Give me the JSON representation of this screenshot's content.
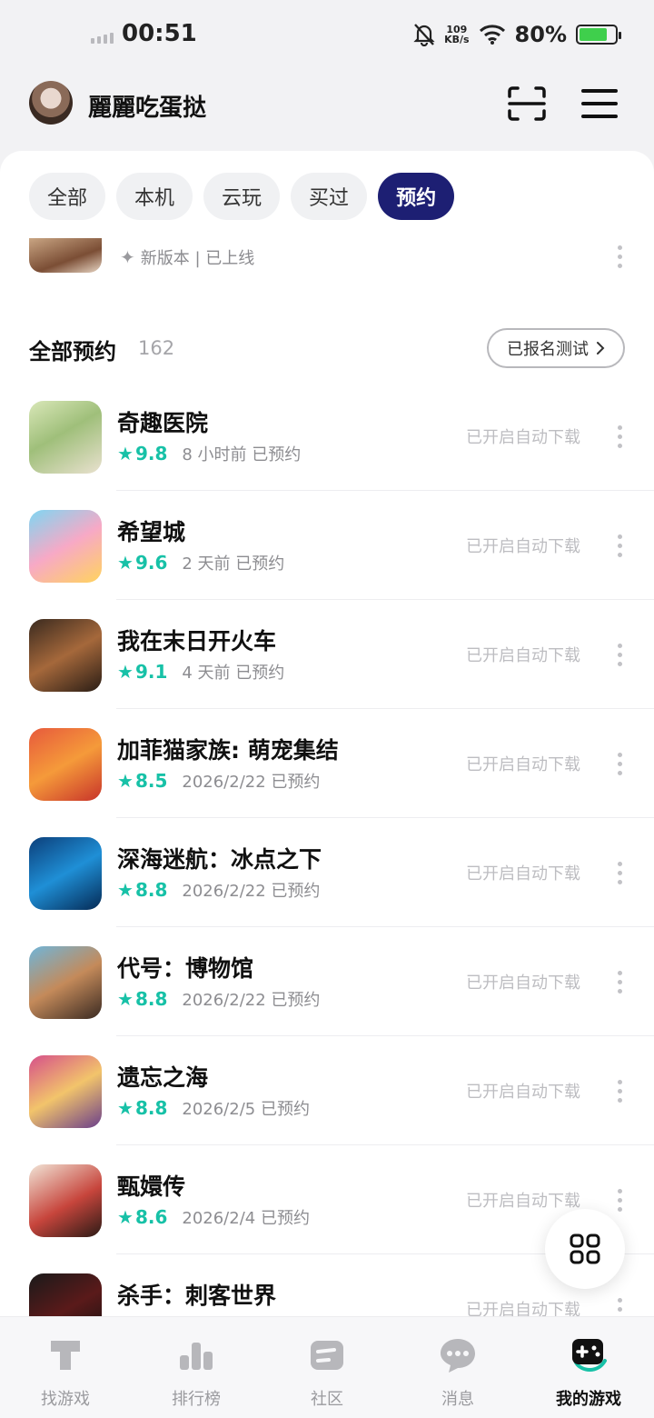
{
  "status_bar": {
    "time": "00:51",
    "net_speed_value": "109",
    "net_speed_unit": "KB/s",
    "battery": "80%",
    "battery_level": 0.8,
    "icons": [
      "signal-icon",
      "mute-icon",
      "wifi-icon",
      "battery-icon"
    ]
  },
  "header": {
    "username": "麗麗吃蛋挞",
    "icons": [
      "avatar",
      "scan-icon",
      "menu-icon"
    ]
  },
  "tabs": [
    {
      "label": "全部",
      "active": false
    },
    {
      "label": "本机",
      "active": false
    },
    {
      "label": "云玩",
      "active": false
    },
    {
      "label": "买过",
      "active": false
    },
    {
      "label": "预约",
      "active": true
    }
  ],
  "partial_item": {
    "status": "新版本 | 已上线",
    "icon": "sparkle-icon"
  },
  "section": {
    "title": "全部预约",
    "count": "162",
    "test_button": "已报名测试"
  },
  "games": [
    {
      "name": "奇趣医院",
      "score": "9.8",
      "when": "8 小时前 已预约",
      "action": "已开启自动下载"
    },
    {
      "name": "希望城",
      "score": "9.6",
      "when": "2 天前 已预约",
      "action": "已开启自动下载"
    },
    {
      "name": "我在末日开火车",
      "score": "9.1",
      "when": "4 天前 已预约",
      "action": "已开启自动下载"
    },
    {
      "name": "加菲猫家族: 萌宠集结",
      "score": "8.5",
      "when": "2026/2/22 已预约",
      "action": "已开启自动下载"
    },
    {
      "name": "深海迷航：冰点之下",
      "score": "8.8",
      "when": "2026/2/22 已预约",
      "action": "已开启自动下载"
    },
    {
      "name": "代号：博物馆",
      "score": "8.8",
      "when": "2026/2/22 已预约",
      "action": "已开启自动下载"
    },
    {
      "name": "遗忘之海",
      "score": "8.8",
      "when": "2026/2/5 已预约",
      "action": "已开启自动下载"
    },
    {
      "name": "甄嬛传",
      "score": "8.6",
      "when": "2026/2/4 已预约",
      "action": "已开启自动下载"
    },
    {
      "name": "杀手：刺客世界",
      "score": "",
      "when": "",
      "action": "已开启自动下载"
    }
  ],
  "fab": {
    "icon": "grid-icon"
  },
  "bottom_nav": [
    {
      "label": "找游戏",
      "icon": "find-games-icon",
      "active": false
    },
    {
      "label": "排行榜",
      "icon": "ranking-icon",
      "active": false
    },
    {
      "label": "社区",
      "icon": "community-icon",
      "active": false
    },
    {
      "label": "消息",
      "icon": "message-icon",
      "active": false
    },
    {
      "label": "我的游戏",
      "icon": "my-games-icon",
      "active": true
    }
  ],
  "colors": {
    "accent_tab": "#1d1f73",
    "score_green": "#17c1a7",
    "background": "#f2f2f4"
  }
}
